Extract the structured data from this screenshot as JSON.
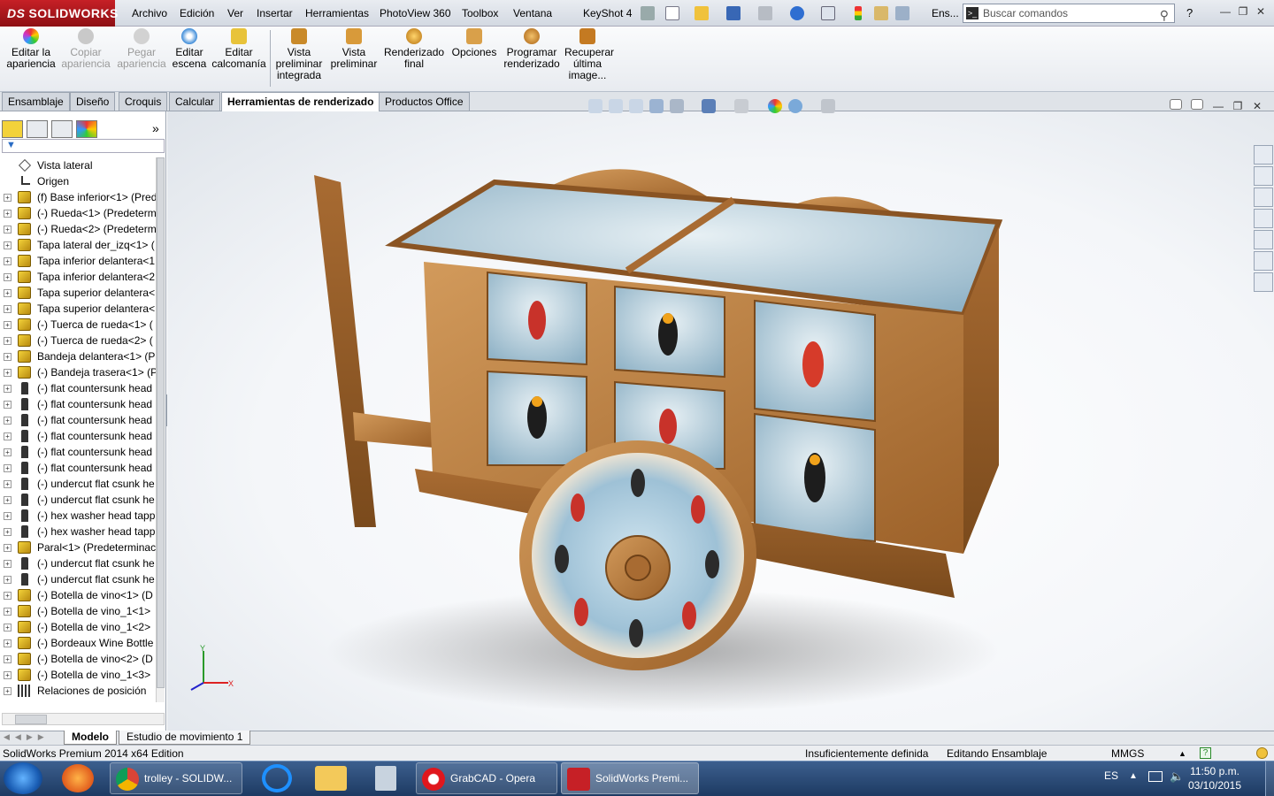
{
  "app": {
    "logo_text": "SOLIDWORKS",
    "logo_prefix": "DS"
  },
  "menu": [
    "Archivo",
    "Edición",
    "Ver",
    "Insertar",
    "Herramientas",
    "PhotoView 360",
    "Toolbox",
    "Ventana",
    "KeyShot 4"
  ],
  "quick_access": {
    "help_glyph": "?",
    "search_label_truncated": "Ens...",
    "search_placeholder": "Buscar comandos"
  },
  "ribbon": {
    "buttons": [
      {
        "label": "Editar la apariencia",
        "enabled": true,
        "icon": "appearance-icon"
      },
      {
        "label": "Copiar apariencia",
        "enabled": false,
        "icon": "copy-appearance-icon"
      },
      {
        "label": "Pegar apariencia",
        "enabled": false,
        "icon": "paste-appearance-icon"
      },
      {
        "label": "Editar escena",
        "enabled": true,
        "icon": "scene-icon"
      },
      {
        "label": "Editar calcomanía",
        "enabled": true,
        "icon": "decal-icon"
      },
      {
        "label": "Vista preliminar integrada",
        "enabled": true,
        "icon": "integrated-preview-icon"
      },
      {
        "label": "Vista preliminar",
        "enabled": true,
        "icon": "preview-window-icon"
      },
      {
        "label": "Renderizado final",
        "enabled": true,
        "icon": "final-render-icon"
      },
      {
        "label": "Opciones",
        "enabled": true,
        "icon": "options-icon"
      },
      {
        "label": "Programar renderizado",
        "enabled": true,
        "icon": "schedule-render-icon"
      },
      {
        "label": "Recuperar última image...",
        "enabled": true,
        "icon": "recover-image-icon"
      }
    ]
  },
  "command_tabs": [
    {
      "label": "Ensamblaje",
      "active": false
    },
    {
      "label": "Diseño",
      "active": false
    },
    {
      "label": "Croquis",
      "active": false
    },
    {
      "label": "Calcular",
      "active": false
    },
    {
      "label": "Herramientas de renderizado",
      "active": true
    },
    {
      "label": "Productos Office",
      "active": false
    }
  ],
  "feature_tree": {
    "items": [
      {
        "label": "Vista lateral",
        "icon": "view",
        "expandable": false
      },
      {
        "label": "Origen",
        "icon": "origin",
        "expandable": false
      },
      {
        "label": "(f) Base inferior<1> (Pred",
        "icon": "part",
        "expandable": true
      },
      {
        "label": "(-) Rueda<1> (Predeterm",
        "icon": "part",
        "expandable": true
      },
      {
        "label": "(-) Rueda<2> (Predeterm",
        "icon": "part",
        "expandable": true
      },
      {
        "label": "Tapa lateral der_izq<1> (",
        "icon": "part",
        "expandable": true
      },
      {
        "label": "Tapa inferior delantera<1",
        "icon": "part",
        "expandable": true
      },
      {
        "label": "Tapa inferior delantera<2",
        "icon": "part",
        "expandable": true
      },
      {
        "label": "Tapa superior delantera<",
        "icon": "part",
        "expandable": true
      },
      {
        "label": "Tapa superior delantera<",
        "icon": "part",
        "expandable": true
      },
      {
        "label": "(-) Tuerca de rueda<1> (",
        "icon": "part",
        "expandable": true
      },
      {
        "label": "(-) Tuerca de rueda<2> (",
        "icon": "part",
        "expandable": true
      },
      {
        "label": "Bandeja delantera<1> (P",
        "icon": "part",
        "expandable": true
      },
      {
        "label": "(-) Bandeja trasera<1> (P",
        "icon": "part",
        "expandable": true
      },
      {
        "label": "(-) flat countersunk head",
        "icon": "screw",
        "expandable": true
      },
      {
        "label": "(-) flat countersunk head",
        "icon": "screw",
        "expandable": true
      },
      {
        "label": "(-) flat countersunk head",
        "icon": "screw",
        "expandable": true
      },
      {
        "label": "(-) flat countersunk head",
        "icon": "screw",
        "expandable": true
      },
      {
        "label": "(-) flat countersunk head",
        "icon": "screw",
        "expandable": true
      },
      {
        "label": "(-) flat countersunk head",
        "icon": "screw",
        "expandable": true
      },
      {
        "label": "(-) undercut flat csunk he",
        "icon": "screw",
        "expandable": true
      },
      {
        "label": "(-) undercut flat csunk he",
        "icon": "screw",
        "expandable": true
      },
      {
        "label": "(-) hex washer head tapp",
        "icon": "screw",
        "expandable": true
      },
      {
        "label": "(-) hex washer head tapp",
        "icon": "screw",
        "expandable": true
      },
      {
        "label": "Paral<1> (Predeterminac",
        "icon": "part",
        "expandable": true
      },
      {
        "label": "(-) undercut flat csunk he",
        "icon": "screw",
        "expandable": true
      },
      {
        "label": "(-) undercut flat csunk he",
        "icon": "screw",
        "expandable": true
      },
      {
        "label": "(-) Botella de vino<1> (D",
        "icon": "part",
        "expandable": true
      },
      {
        "label": "(-) Botella de vino_1<1>",
        "icon": "part",
        "expandable": true
      },
      {
        "label": "(-) Botella de vino_1<2>",
        "icon": "part",
        "expandable": true
      },
      {
        "label": "(-) Bordeaux Wine Bottle",
        "icon": "part",
        "expandable": true
      },
      {
        "label": "(-) Botella de vino<2> (D",
        "icon": "part",
        "expandable": true
      },
      {
        "label": "(-) Botella de vino_1<3>",
        "icon": "part",
        "expandable": true
      },
      {
        "label": "Relaciones de posición",
        "icon": "mate",
        "expandable": true
      }
    ]
  },
  "bottom_tabs": [
    {
      "label": "Modelo",
      "active": true
    },
    {
      "label": "Estudio de movimiento 1",
      "active": false
    }
  ],
  "status": {
    "edition": "SolidWorks Premium 2014 x64 Edition",
    "definition": "Insuficientemente definida",
    "mode": "Editando Ensamblaje",
    "units": "MMGS"
  },
  "taskbar": {
    "items": [
      {
        "label": "trolley - SOLIDW...",
        "icon": "chrome-icon"
      },
      {
        "label": "GrabCAD - Opera",
        "icon": "opera-icon"
      },
      {
        "label": "SolidWorks Premi...",
        "icon": "solidworks-icon"
      }
    ],
    "language": "ES",
    "time": "11:50 p.m.",
    "date": "03/10/2015"
  },
  "colors": {
    "brand_red": "#c62026",
    "wood": "#b97a3c",
    "wood_dark": "#8a5423",
    "panel_sky": "#c7dbe6"
  },
  "triad": {
    "x": "X",
    "y": "Y"
  }
}
